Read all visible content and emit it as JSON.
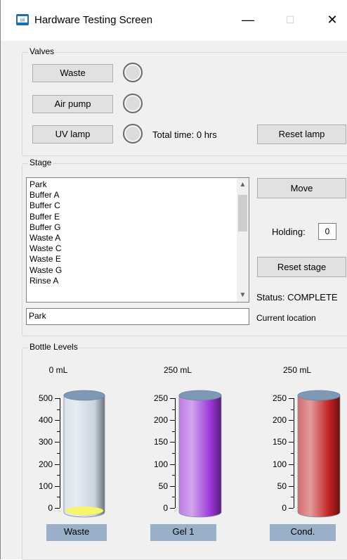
{
  "window": {
    "title": "Hardware Testing Screen",
    "minimize": "—",
    "maximize": "☐",
    "close": "✕"
  },
  "valves": {
    "label": "Valves",
    "waste_btn": "Waste",
    "air_pump_btn": "Air pump",
    "uv_lamp_btn": "UV lamp",
    "total_time": "Total time: 0 hrs",
    "reset_lamp_btn": "Reset lamp"
  },
  "stage": {
    "label": "Stage",
    "list": [
      "Park",
      "Buffer A",
      "Buffer C",
      "Buffer E",
      "Buffer G",
      "Waste A",
      "Waste C",
      "Waste E",
      "Waste G",
      "Rinse A"
    ],
    "move_btn": "Move",
    "holding_label": "Holding:",
    "holding_value": "0",
    "reset_stage_btn": "Reset stage",
    "status": "Status: COMPLETE",
    "current_value": "Park",
    "current_label": "Current location"
  },
  "bottles": {
    "label": "Bottle Levels",
    "items": [
      {
        "name": "Waste",
        "level_text": "0 mL",
        "scale": [
          "500",
          "400",
          "300",
          "200",
          "100",
          "0"
        ],
        "fill_fraction": 0.0,
        "color": "#c8d4e0",
        "liquid": "#f7f56a"
      },
      {
        "name": "Gel 1",
        "level_text": "250 mL",
        "scale": [
          "250",
          "200",
          "150",
          "100",
          "50",
          "0"
        ],
        "fill_fraction": 1.0,
        "color": "#9b36d9",
        "liquid": "#9b36d9"
      },
      {
        "name": "Cond.",
        "level_text": "250 mL",
        "scale": [
          "250",
          "200",
          "150",
          "100",
          "50",
          "0"
        ],
        "fill_fraction": 1.0,
        "color": "#c02020",
        "liquid": "#c02020"
      }
    ]
  }
}
